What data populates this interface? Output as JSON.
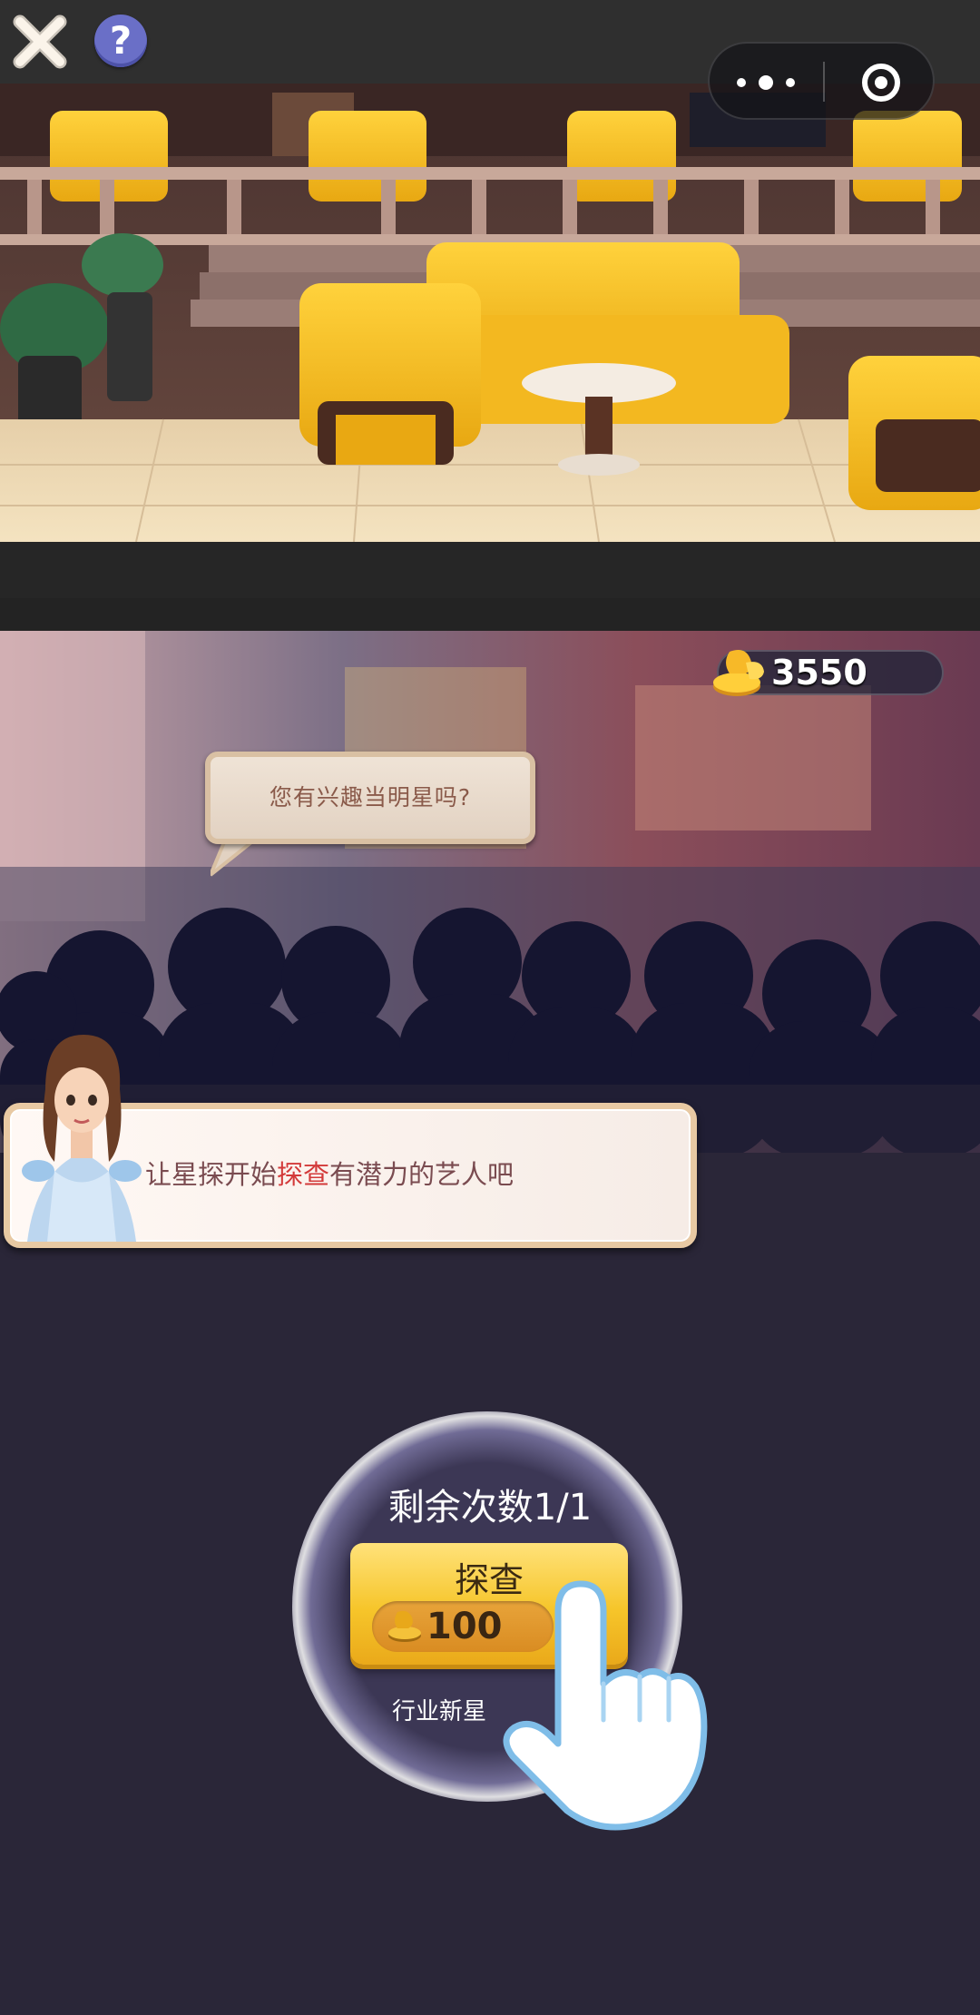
{
  "topbar": {
    "close_icon": "close-x-icon",
    "help_label": "?",
    "menu_icon": "more-dots-icon",
    "record_icon": "target-circle-icon"
  },
  "scene": {
    "top_description_icon": "lounge-scene",
    "crowd_icon": "crowd-scene"
  },
  "currency": {
    "icon": "gold-coins-icon",
    "amount": "3550"
  },
  "speech": {
    "text": "您有兴趣当明星吗?"
  },
  "dialog": {
    "text_before": "让星探开始",
    "text_highlight": "探查",
    "text_after": "有潜力的艺人吧",
    "character_icon": "hostess-avatar"
  },
  "action": {
    "remaining": "剩余次数1/1",
    "button_label": "探查",
    "cost": "100",
    "cost_icon": "gold-coins-icon",
    "reward_label": "行业新星",
    "pointer_icon": "tap-hand-icon"
  },
  "colors": {
    "background": "#2a2638",
    "button_gold": "#f6c52a",
    "highlight_red": "#d33a3a",
    "help_purple": "#6a6fc7"
  }
}
